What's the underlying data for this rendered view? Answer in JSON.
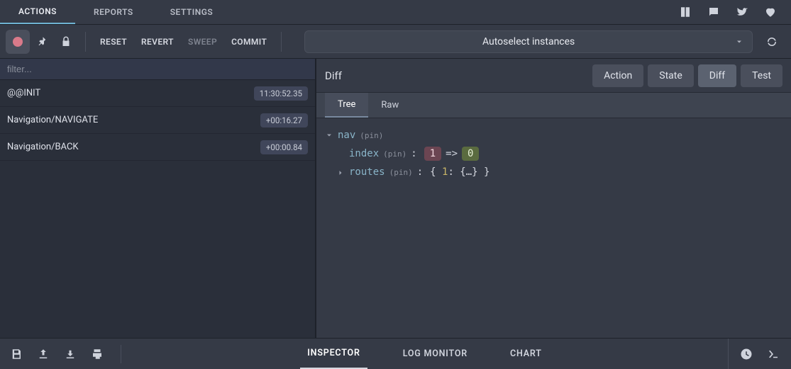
{
  "top_tabs": {
    "actions": "ACTIONS",
    "reports": "REPORTS",
    "settings": "SETTINGS"
  },
  "toolbar": {
    "reset": "RESET",
    "revert": "REVERT",
    "sweep": "SWEEP",
    "commit": "COMMIT"
  },
  "instance_selector": "Autoselect instances",
  "filter_placeholder": "filter...",
  "actions": [
    {
      "name": "@@INIT",
      "time": "11:30:52.35"
    },
    {
      "name": "Navigation/NAVIGATE",
      "time": "+00:16.27"
    },
    {
      "name": "Navigation/BACK",
      "time": "+00:00.84"
    }
  ],
  "right": {
    "title": "Diff",
    "seg": {
      "action": "Action",
      "state": "State",
      "diff": "Diff",
      "test": "Test"
    },
    "subtabs": {
      "tree": "Tree",
      "raw": "Raw"
    }
  },
  "diff": {
    "root_key": "nav",
    "pin_label": "(pin)",
    "index": {
      "key": "index",
      "old": "1",
      "arrow": "=>",
      "new": "0"
    },
    "routes": {
      "key": "routes",
      "summary_open": "{ ",
      "summary_num": "1",
      "summary_mid": ": {…} ",
      "summary_close": "}"
    }
  },
  "bottom_tabs": {
    "inspector": "INSPECTOR",
    "log": "LOG MONITOR",
    "chart": "CHART"
  }
}
